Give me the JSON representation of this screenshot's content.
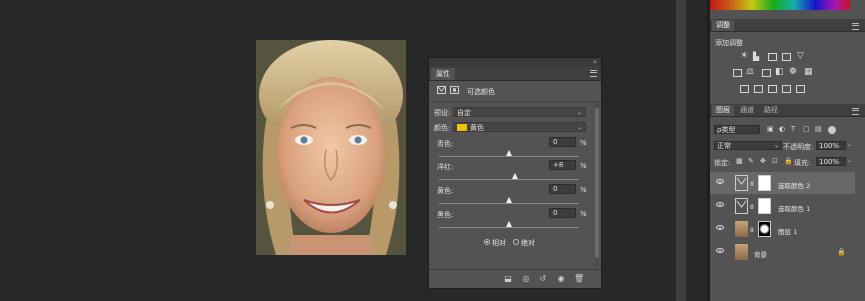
{
  "properties": {
    "tab_label": "属性",
    "header_label": "可选颜色",
    "preset_label": "预设:",
    "preset_value": "自定",
    "colors_label": "颜色:",
    "colors_value": "黄色",
    "colors_swatch": "#f2c200",
    "sliders": [
      {
        "name": "cyan",
        "label": "青色:",
        "value": "0",
        "unit": "%",
        "level": 0
      },
      {
        "name": "magenta",
        "label": "洋红:",
        "value": "+8",
        "unit": "%",
        "level": 8
      },
      {
        "name": "yellow",
        "label": "黄色:",
        "value": "0",
        "unit": "%",
        "level": 0
      },
      {
        "name": "black",
        "label": "黑色:",
        "value": "0",
        "unit": "%",
        "level": 0
      }
    ],
    "method_relative": "相对",
    "method_absolute": "绝对",
    "method_selected": "相对"
  },
  "adjustments": {
    "tab_label": "调整",
    "add_label": "添加调整"
  },
  "layers": {
    "tabs": [
      "图层",
      "通道",
      "路径"
    ],
    "filter_value": "ρ类型",
    "blend_mode": "正常",
    "opacity_label": "不透明度:",
    "opacity_value": "100%",
    "lock_label": "锁定:",
    "fill_label": "填充:",
    "fill_value": "100%",
    "items": [
      {
        "name": "选取颜色 2",
        "selected": true
      },
      {
        "name": "选取颜色 1",
        "selected": false
      },
      {
        "name": "图层 1",
        "selected": false
      },
      {
        "name": "背景",
        "selected": false
      }
    ]
  },
  "colors": {
    "accent_yellow": "#f2c200",
    "panel_bg": "#535353",
    "canvas_bg": "#282828"
  }
}
